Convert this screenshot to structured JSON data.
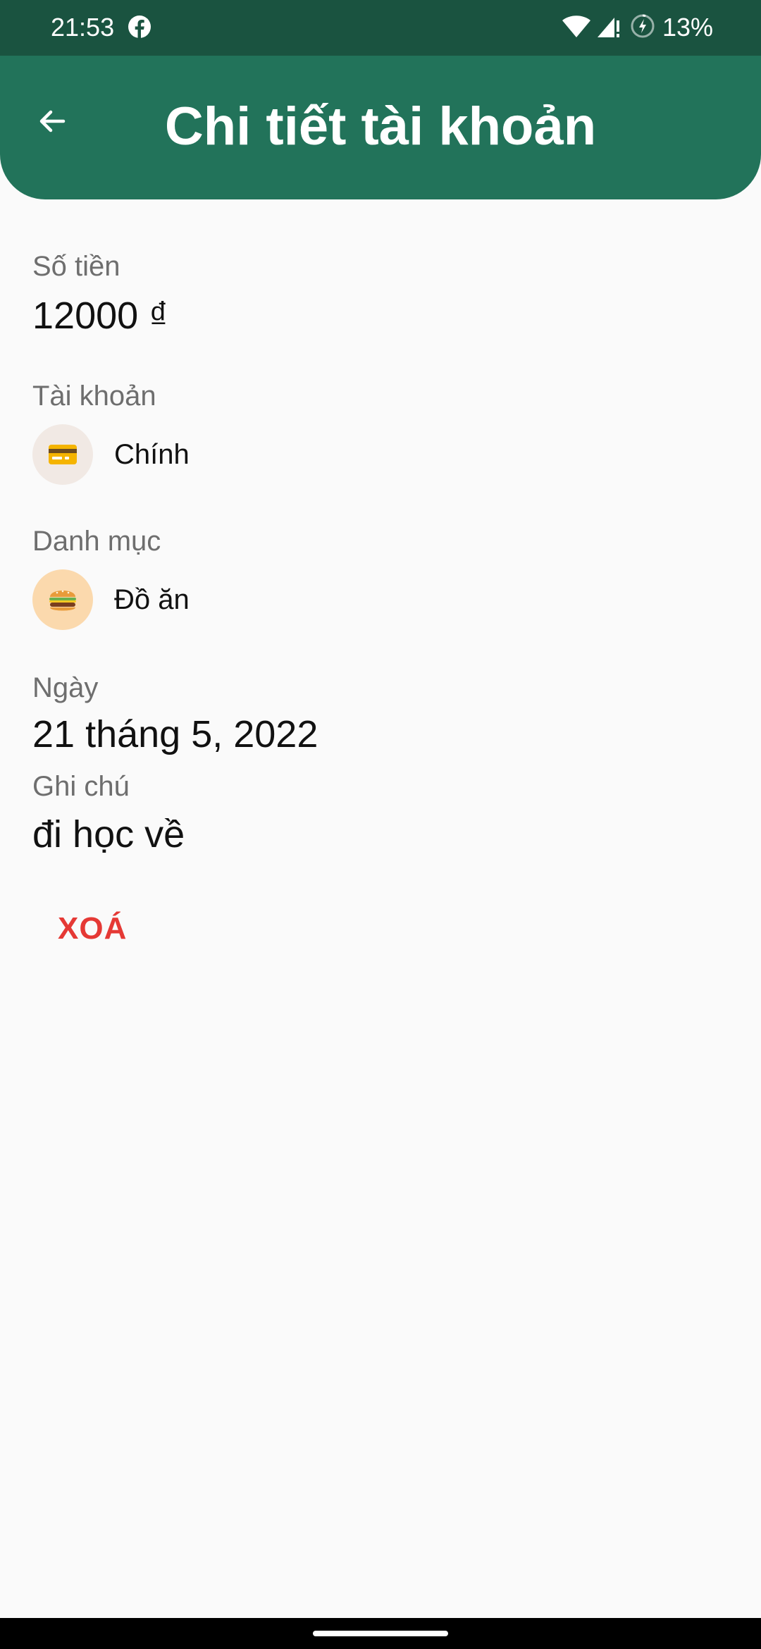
{
  "status_bar": {
    "time": "21:53",
    "battery": "13%",
    "icons": [
      "facebook-icon",
      "wifi-icon",
      "signal-icon",
      "battery-saver-icon"
    ]
  },
  "app_bar": {
    "title": "Chi tiết tài khoản",
    "back_icon": "arrow-left-icon",
    "color": "#22735a"
  },
  "detail": {
    "amount": {
      "label": "Số tiền",
      "value": "12000 ₫"
    },
    "account": {
      "label": "Tài khoản",
      "icon": "credit-card-icon",
      "name": "Chính"
    },
    "category": {
      "label": "Danh mục",
      "icon": "hamburger-icon",
      "name": "Đồ ăn"
    },
    "date": {
      "label": "Ngày",
      "value": "21 tháng 5, 2022"
    },
    "note": {
      "label": "Ghi chú",
      "value": "đi học về"
    }
  },
  "actions": {
    "delete_label": "XOÁ",
    "delete_color": "#e53935"
  }
}
